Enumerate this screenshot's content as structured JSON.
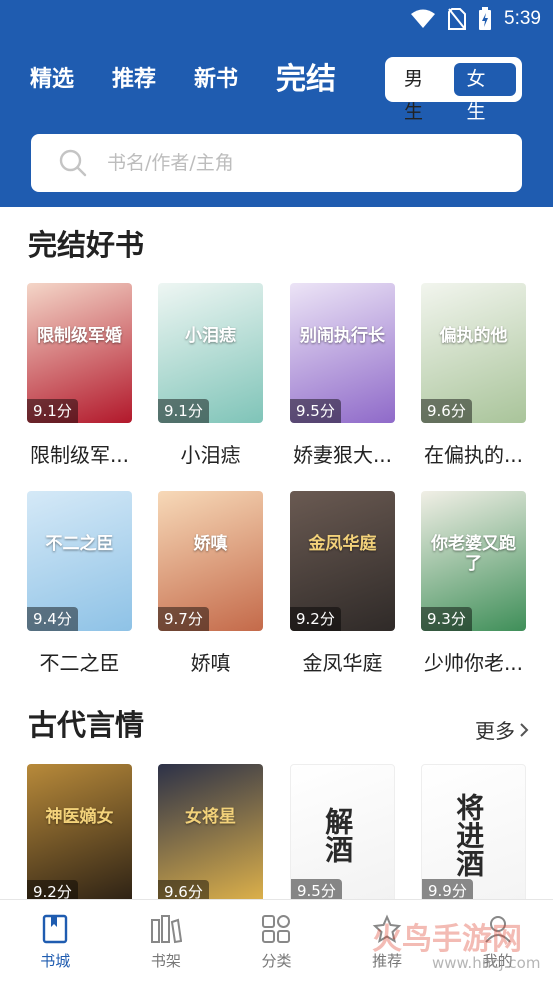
{
  "status": {
    "time": "5:39"
  },
  "header": {
    "tabs": [
      "精选",
      "推荐",
      "新书",
      "完结"
    ],
    "gender": {
      "male": "男生",
      "female": "女生"
    },
    "search_placeholder": "书名/作者/主角"
  },
  "sections": [
    {
      "title": "完结好书",
      "books": [
        {
          "title": "限制级军...",
          "score": "9.1分",
          "cover_text": "限制级军婚",
          "colors": [
            "#f4d6c8",
            "#b2182b"
          ]
        },
        {
          "title": "小泪痣",
          "score": "9.1分",
          "cover_text": "小泪痣",
          "colors": [
            "#eef6f3",
            "#7fc4b8"
          ]
        },
        {
          "title": "娇妻狠大...",
          "score": "9.5分",
          "cover_text": "别闹执行长",
          "colors": [
            "#ece4f6",
            "#8f6ac9"
          ]
        },
        {
          "title": "在偏执的...",
          "score": "9.6分",
          "cover_text": "偏执的他",
          "colors": [
            "#f2f5ee",
            "#a9c49a"
          ]
        }
      ]
    },
    {
      "title": "",
      "books": [
        {
          "title": "不二之臣",
          "score": "9.4分",
          "cover_text": "不二之臣",
          "colors": [
            "#d5e9f7",
            "#8ec2e6"
          ]
        },
        {
          "title": "娇嗔",
          "score": "9.7分",
          "cover_text": "娇嗔",
          "colors": [
            "#f7d9b8",
            "#c46a4a"
          ]
        },
        {
          "title": "金凤华庭",
          "score": "9.2分",
          "cover_text": "金凤华庭",
          "colors": [
            "#6a5a52",
            "#2f2a28"
          ]
        },
        {
          "title": "少帅你老...",
          "score": "9.3分",
          "cover_text": "你老婆又跑了",
          "colors": [
            "#f1efe6",
            "#3f8f59"
          ]
        }
      ]
    },
    {
      "title": "古代言情",
      "more": "更多",
      "books": [
        {
          "title": "神医嫡女",
          "score": "9.2分",
          "cover_text": "神医嫡女",
          "colors": [
            "#b88a3a",
            "#2b2014"
          ]
        },
        {
          "title": "女将星",
          "score": "9.6分",
          "cover_text": "女将星",
          "colors": [
            "#2c3148",
            "#e0b34a"
          ]
        },
        {
          "title": "解酒",
          "score": "9.5分",
          "cover_text": "解酒",
          "colors": [
            "#ffffff",
            "#f2f2f2"
          ]
        },
        {
          "title": "将进酒",
          "score": "9.9分",
          "cover_text": "将进酒",
          "colors": [
            "#ffffff",
            "#f4f4f4"
          ]
        }
      ]
    }
  ],
  "nav": [
    "书城",
    "书架",
    "分类",
    "推荐",
    "我的"
  ],
  "watermark": {
    "text": "火鸟手游网",
    "url": "www.hncj.com"
  },
  "accent": "#1f5cb0"
}
